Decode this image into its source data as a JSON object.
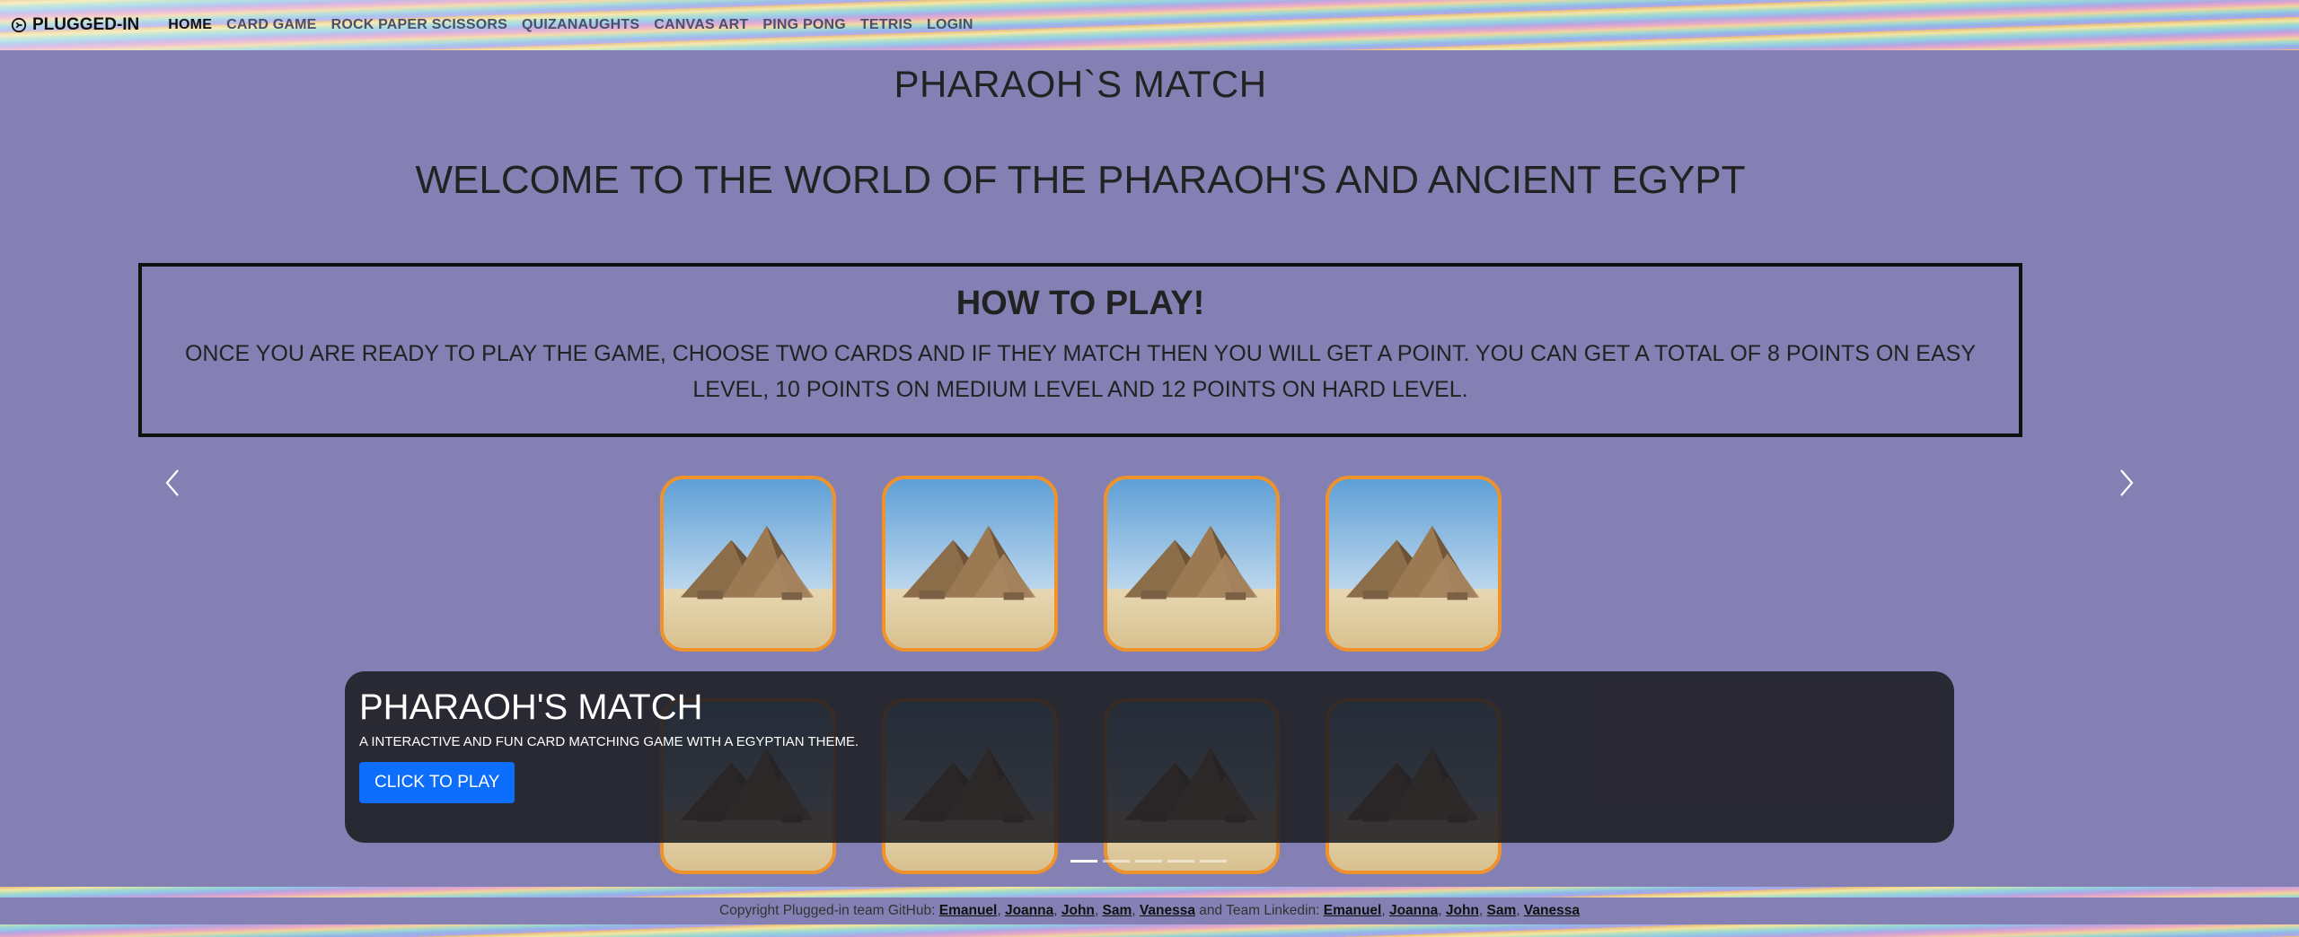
{
  "nav": {
    "brand": "PLUGGED-IN",
    "brand_icon": "plug-circle-icon",
    "links": [
      {
        "label": "HOME",
        "active": true
      },
      {
        "label": "CARD GAME"
      },
      {
        "label": "ROCK PAPER SCISSORS"
      },
      {
        "label": "QUIZANAUGHTS"
      },
      {
        "label": "CANVAS ART"
      },
      {
        "label": "PING PONG"
      },
      {
        "label": "TETRIS"
      },
      {
        "label": "LOGIN"
      }
    ]
  },
  "main": {
    "title": "PHARAOH`S MATCH",
    "welcome": "WELCOME TO THE WORLD OF THE PHARAOH'S AND ANCIENT EGYPT",
    "howto": {
      "title": "HOW TO PLAY!",
      "text": "ONCE YOU ARE READY TO PLAY THE GAME, CHOOSE TWO CARDS AND IF THEY MATCH THEN YOU WILL GET A POINT. YOU CAN GET A TOTAL OF 8 POINTS ON EASY LEVEL, 10 POINTS ON MEDIUM LEVEL AND 12 POINTS ON HARD LEVEL."
    }
  },
  "carousel": {
    "prev_icon": "chevron-left-icon",
    "next_icon": "chevron-right-icon",
    "card_image": "pyramids-image",
    "caption_title": "PHARAOH'S MATCH",
    "caption_sub": "A INTERACTIVE AND FUN CARD MATCHING GAME WITH A EGYPTIAN THEME.",
    "button_label": "CLICK TO PLAY",
    "slides": 5,
    "active_slide": 1
  },
  "footer": {
    "prefix": "Copyright Plugged-in team GitHub:",
    "github": [
      "Emanuel",
      "Joanna",
      "John",
      "Sam",
      "Vanessa"
    ],
    "middle": "and Team Linkedin:",
    "linkedin": [
      "Emanuel",
      "Joanna",
      "John",
      "Sam",
      "Vanessa"
    ]
  },
  "colors": {
    "background": "#8480b3",
    "card_border": "#f0922a",
    "button": "#0d6efd",
    "caption_bg": "#1c1c22"
  }
}
